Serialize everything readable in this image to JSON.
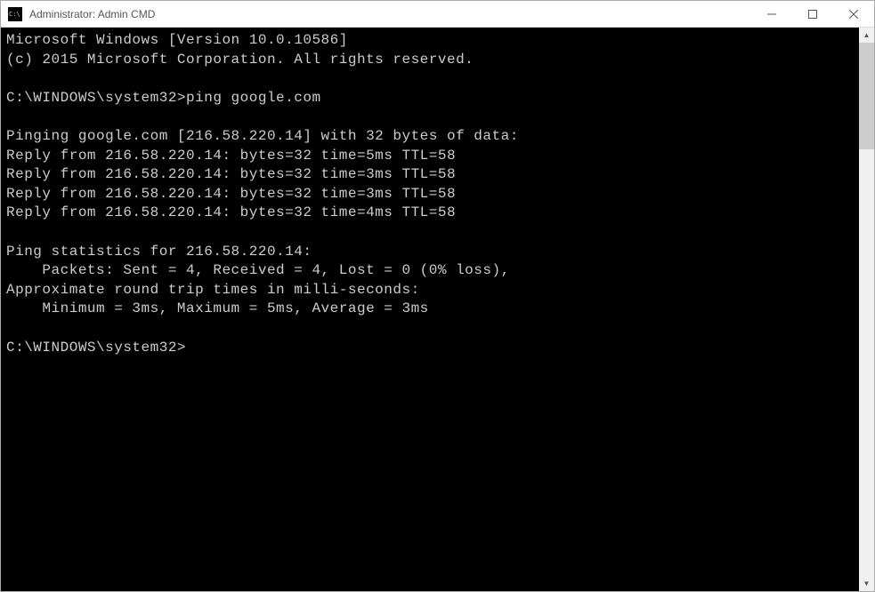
{
  "window": {
    "title": "Administrator: Admin CMD"
  },
  "terminal": {
    "lines": [
      "Microsoft Windows [Version 10.0.10586]",
      "(c) 2015 Microsoft Corporation. All rights reserved.",
      "",
      "C:\\WINDOWS\\system32>ping google.com",
      "",
      "Pinging google.com [216.58.220.14] with 32 bytes of data:",
      "Reply from 216.58.220.14: bytes=32 time=5ms TTL=58",
      "Reply from 216.58.220.14: bytes=32 time=3ms TTL=58",
      "Reply from 216.58.220.14: bytes=32 time=3ms TTL=58",
      "Reply from 216.58.220.14: bytes=32 time=4ms TTL=58",
      "",
      "Ping statistics for 216.58.220.14:",
      "    Packets: Sent = 4, Received = 4, Lost = 0 (0% loss),",
      "Approximate round trip times in milli-seconds:",
      "    Minimum = 3ms, Maximum = 5ms, Average = 3ms",
      "",
      "C:\\WINDOWS\\system32>"
    ]
  }
}
